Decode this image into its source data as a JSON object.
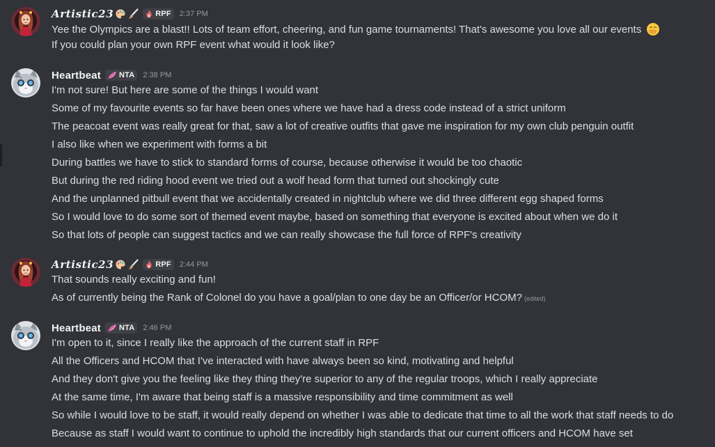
{
  "messages": [
    {
      "author": "Artistic23",
      "author_emoji": [
        "palette-icon",
        "paintbrush-icon"
      ],
      "tag": "RPF",
      "tag_icon": "flame-icon",
      "timestamp": "2:37 PM",
      "lines": [
        {
          "text": "Yee the Olympics are a blast!! Lots of team effort, cheering, and fun game tournaments! That's awesome you love all our events",
          "emoji": "hand-over-mouth-icon"
        },
        {
          "text": "If you could plan your own RPF event what would it look like?"
        }
      ]
    },
    {
      "author": "Heartbeat",
      "tag": "NTA",
      "tag_icon": "feather-icon",
      "timestamp": "2:38 PM",
      "lines": [
        {
          "text": "I'm not sure! But here are some of the things I would want"
        },
        {
          "text": "Some of my favourite events so far have been ones where we have had a dress code instead of a strict uniform"
        },
        {
          "text": "The peacoat event was really great for that, saw a lot of creative outfits that gave me inspiration for my own club penguin outfit"
        },
        {
          "text": "I also like when we experiment with forms a bit"
        },
        {
          "text": "During battles we have to stick to standard forms of course, because otherwise it would be too chaotic"
        },
        {
          "text": "But during the red riding hood event we tried out a wolf head form that turned out shockingly cute"
        },
        {
          "text": "And the unplanned pitbull event that we accidentally created in nightclub where we did three different egg shaped forms"
        },
        {
          "text": "So I would love to do some sort of themed event maybe, based on something that everyone is excited about when we do it"
        },
        {
          "text": "So that lots of people can suggest tactics and we can really showcase the full force of RPF's creativity"
        }
      ]
    },
    {
      "author": "Artistic23",
      "author_emoji": [
        "palette-icon",
        "paintbrush-icon"
      ],
      "tag": "RPF",
      "tag_icon": "flame-icon",
      "timestamp": "2:44 PM",
      "lines": [
        {
          "text": "That sounds really exciting and fun!"
        },
        {
          "text": "As of currently being the Rank of Colonel do you have a goal/plan to one day be an Officer/or HCOM?",
          "edited": "(edited)"
        }
      ]
    },
    {
      "author": "Heartbeat",
      "tag": "NTA",
      "tag_icon": "feather-icon",
      "timestamp": "2:46 PM",
      "lines": [
        {
          "text": "I'm open to it, since I really like the approach of the current staff in RPF"
        },
        {
          "text": "All the Officers and HCOM that I've interacted with have always been so kind, motivating and helpful"
        },
        {
          "text": "And they don't give you the feeling like they thing they're superior to any of the regular troops, which I really appreciate"
        },
        {
          "text": "At the same time, I'm aware that being staff is a massive responsibility and time commitment as well"
        },
        {
          "text": "So while I would love to be staff, it would really depend on whether I was able to dedicate that time to all the work that staff needs to do"
        },
        {
          "text": "Because as staff I would want to continue to uphold the incredibly high standards that our current officers and HCOM have set"
        }
      ]
    }
  ],
  "colors": {
    "background": "#313338",
    "text": "#dbdee1",
    "username": "#f2f3f5",
    "muted": "#949ba4",
    "tag_bg": "#3f4147"
  }
}
